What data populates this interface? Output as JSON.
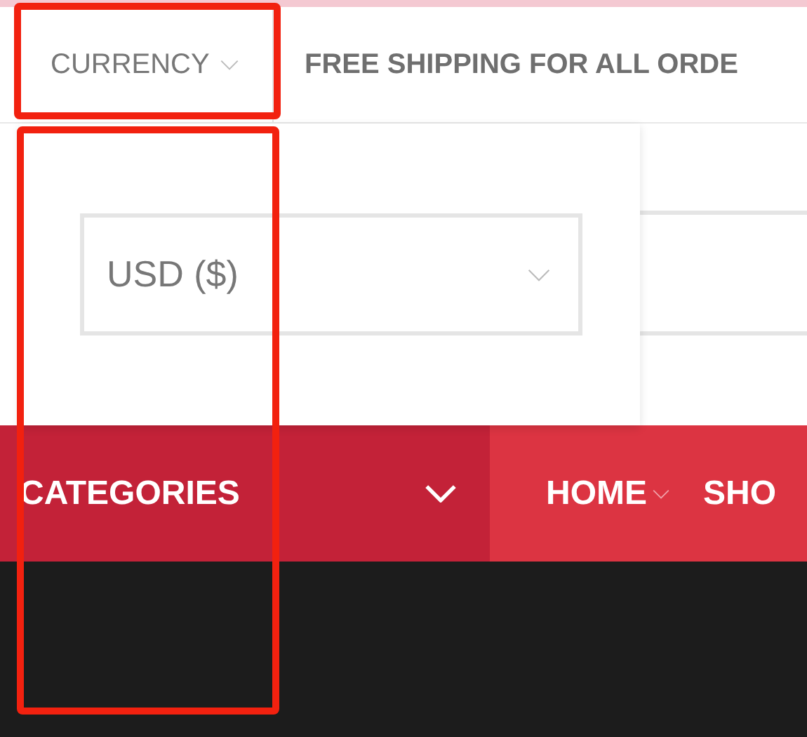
{
  "topbar": {
    "currency": {
      "label": "CURRENCY"
    },
    "notice": "FREE SHIPPING FOR ALL ORDE"
  },
  "currency_dropdown": {
    "value": "USD ($)"
  },
  "nav": {
    "categories_label": "CATEGORIES",
    "items": [
      {
        "label": "HOME",
        "has_submenu": true
      },
      {
        "label": "SHO",
        "has_submenu": false
      }
    ]
  },
  "annotations": [
    {
      "kind": "box"
    },
    {
      "kind": "box"
    }
  ]
}
